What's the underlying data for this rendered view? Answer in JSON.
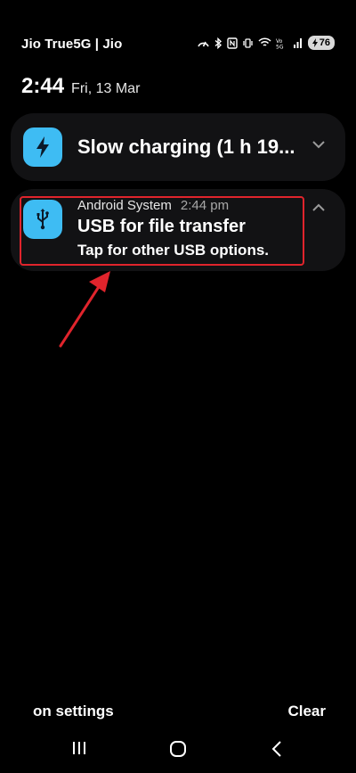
{
  "status_bar": {
    "carrier": "Jio True5G | Jio",
    "battery_level": "76",
    "icons": [
      "data-saver-icon",
      "bluetooth-icon",
      "nfc-icon",
      "vibrate-icon",
      "wifi-icon",
      "volte-5g-icon",
      "signal-icon",
      "battery-icon"
    ]
  },
  "clock": {
    "time": "2:44",
    "date": "Fri, 13 Mar"
  },
  "notifications": {
    "charging": {
      "icon": "lightning-icon",
      "title": "Slow charging (1 h 19..."
    },
    "usb": {
      "icon": "usb-icon",
      "source": "Android System",
      "time": "2:44 pm",
      "title": "USB for file transfer",
      "subtitle": "Tap for other USB options."
    }
  },
  "footer": {
    "settings_label": "on settings",
    "clear_label": "Clear"
  },
  "colors": {
    "background": "#000000",
    "card": "#121214",
    "app_icon": "#3ebcf3",
    "annotation_red": "#e0242c"
  }
}
